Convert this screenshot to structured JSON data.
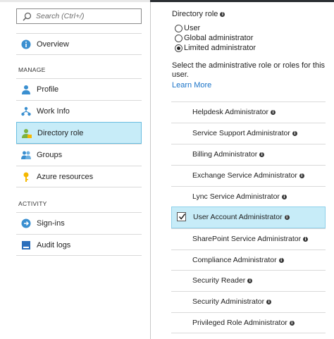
{
  "search": {
    "placeholder": "Search (Ctrl+/)"
  },
  "nav": {
    "overview": "Overview",
    "manage_header": "MANAGE",
    "manage_items": [
      "Profile",
      "Work Info",
      "Directory role",
      "Groups",
      "Azure resources"
    ],
    "activity_header": "ACTIVITY",
    "activity_items": [
      "Sign-ins",
      "Audit logs"
    ],
    "selected": "Directory role"
  },
  "directory_role": {
    "title": "Directory role",
    "options": [
      "User",
      "Global administrator",
      "Limited administrator"
    ],
    "selected_option": "Limited administrator",
    "description": "Select the administrative role or roles for this user.",
    "learn_more": "Learn More",
    "roles": [
      "Helpdesk Administrator",
      "Service Support Administrator",
      "Billing Administrator",
      "Exchange Service Administrator",
      "Lync Service Administrator",
      "User Account Administrator",
      "SharePoint Service Administrator",
      "Compliance Administrator",
      "Security Reader",
      "Security Administrator",
      "Privileged Role Administrator"
    ],
    "checked_role": "User Account Administrator"
  },
  "colors": {
    "selected_bg": "#c7ecf8",
    "selected_border": "#68bde0",
    "link": "#1a73c8",
    "icon_blue": "#3a8fd0"
  }
}
